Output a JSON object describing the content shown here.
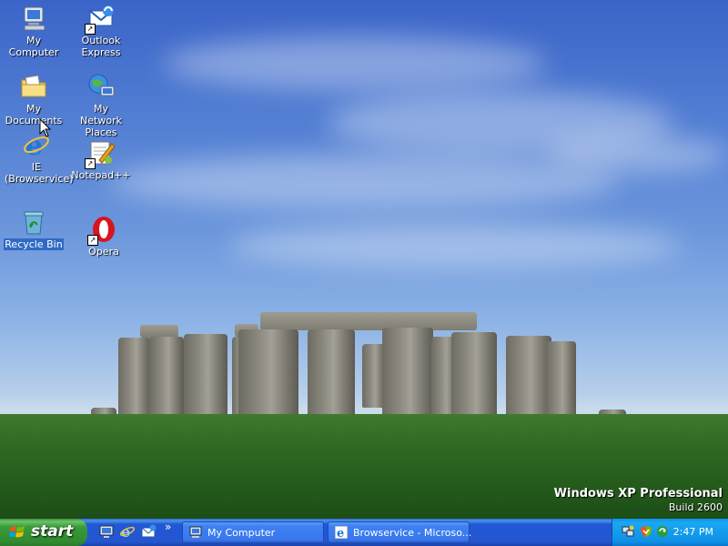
{
  "desktop": {
    "icons": [
      {
        "label": "My Computer",
        "icon": "my-computer-icon"
      },
      {
        "label": "Outlook Express",
        "icon": "outlook-express-icon"
      },
      {
        "label": "My Documents",
        "icon": "my-documents-icon"
      },
      {
        "label": "My Network Places",
        "icon": "network-places-icon"
      },
      {
        "label": "IE (Browservice)",
        "icon": "internet-explorer-icon"
      },
      {
        "label": "Notepad++",
        "icon": "notepadpp-icon"
      },
      {
        "label": "Recycle Bin",
        "icon": "recycle-bin-icon"
      },
      {
        "label": "Opera",
        "icon": "opera-icon"
      }
    ],
    "selected_icon": "Recycle Bin",
    "watermark": {
      "title": "Windows XP Professional",
      "build": "Build 2600"
    }
  },
  "taskbar": {
    "start_label": "start",
    "quick_launch": [
      "show-desktop-icon",
      "internet-explorer-icon",
      "outlook-express-icon"
    ],
    "overflow_label": "»",
    "buttons": [
      {
        "label": "My Computer",
        "icon": "my-computer-icon"
      },
      {
        "label": "Browservice - Microso...",
        "icon": "internet-explorer-icon"
      }
    ],
    "tray": {
      "icons": [
        "network-icon",
        "security-icon",
        "update-icon"
      ],
      "clock": "2:47 PM"
    }
  },
  "colors": {
    "taskbar_blue": "#2456cf",
    "start_green": "#3a9b3a",
    "tray_blue": "#0f8fe6",
    "selection": "#316ac5"
  }
}
